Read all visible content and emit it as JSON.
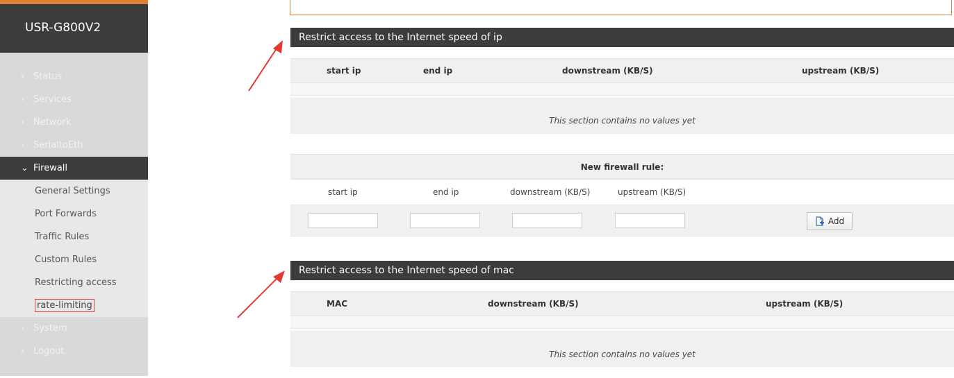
{
  "sidebar": {
    "brand": "USR-G800V2",
    "menu": [
      {
        "label": "Status"
      },
      {
        "label": "Services"
      },
      {
        "label": "Network"
      },
      {
        "label": "SerialtoEth"
      },
      {
        "label": "Firewall"
      }
    ],
    "firewall_submenu": [
      {
        "label": "General Settings"
      },
      {
        "label": "Port Forwards"
      },
      {
        "label": "Traffic Rules"
      },
      {
        "label": "Custom Rules"
      },
      {
        "label": "Restricting access"
      },
      {
        "label": "rate-limiting"
      }
    ],
    "bottom_menu": [
      {
        "label": "System"
      },
      {
        "label": "Logout"
      }
    ]
  },
  "ip_section": {
    "title": "Restrict access to the Internet speed of ip",
    "columns": [
      "start ip",
      "end ip",
      "downstream (KB/S)",
      "upstream (KB/S)"
    ],
    "empty_text": "This section contains no values yet"
  },
  "new_rule": {
    "title": "New firewall rule:",
    "labels": [
      "start ip",
      "end ip",
      "downstream (KB/S)",
      "upstream (KB/S)"
    ],
    "inputs": [
      "",
      "",
      "",
      ""
    ],
    "add_label": "Add"
  },
  "mac_section": {
    "title": "Restrict access to the Internet speed of mac",
    "columns": [
      "MAC",
      "downstream (KB/S)",
      "upstream (KB/S)"
    ],
    "empty_text": "This section contains no values yet"
  },
  "colors": {
    "accent": "#e0813a",
    "dark_header": "#3c3c3c",
    "sidebar_bg": "#d9d9d9",
    "annotation_red": "#e53935"
  }
}
